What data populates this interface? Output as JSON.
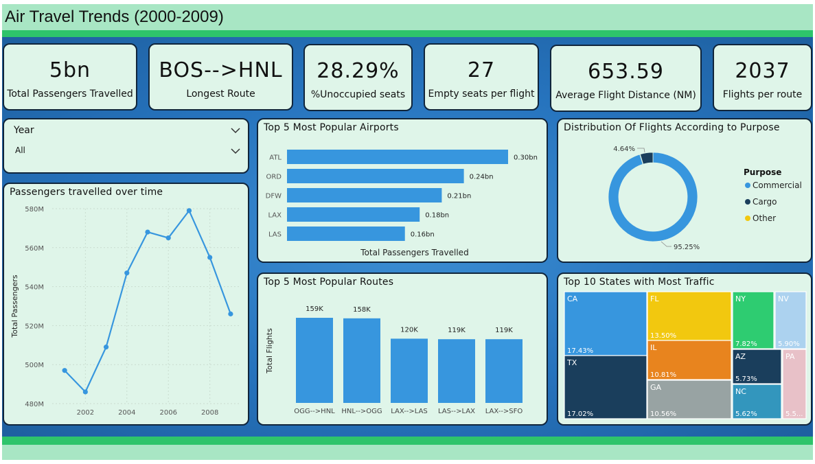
{
  "title": "Air Travel Trends (2000-2009)",
  "kpis": [
    {
      "value": "5bn",
      "label": "Total Passengers Travelled"
    },
    {
      "value": "BOS-->HNL",
      "label": "Longest Route"
    },
    {
      "value": "28.29%",
      "label": "%Unoccupied seats"
    },
    {
      "value": "27",
      "label": "Empty seats per flight"
    },
    {
      "value": "653.59",
      "label": "Average Flight Distance (NM)"
    },
    {
      "value": "2037",
      "label": "Flights per route"
    }
  ],
  "slicer": {
    "label": "Year",
    "value": "All"
  },
  "colors": {
    "accent": "#3796de",
    "dark": "#1a3e5c",
    "yellow": "#f2c80f",
    "card_bg": "#dff5e9",
    "title_bg": "#a8e6c4",
    "strip": "#2ec46b"
  },
  "chart_data": [
    {
      "type": "line",
      "title": "Passengers travelled over time",
      "ylabel": "Total Passengers",
      "xlabel": "",
      "x": [
        2000,
        2001,
        2002,
        2003,
        2004,
        2005,
        2006,
        2007,
        2008,
        2009
      ],
      "y": [
        497,
        486,
        509,
        547,
        568,
        565,
        579,
        555,
        526
      ],
      "x_points": [
        2001,
        2002,
        2003,
        2004,
        2005,
        2006,
        2007,
        2008,
        2009
      ],
      "x_ticks": [
        "2002",
        "2004",
        "2006",
        "2008"
      ],
      "y_ticks": [
        "580M",
        "560M",
        "540M",
        "520M",
        "500M",
        "480M"
      ],
      "ylim": [
        480,
        580
      ],
      "xlim": [
        2000.4,
        2009.5
      ],
      "grid": true
    },
    {
      "type": "bar",
      "orientation": "horizontal",
      "title": "Top 5 Most Popular Airports",
      "xlabel": "Total Passengers Travelled",
      "categories": [
        "ATL",
        "ORD",
        "DFW",
        "LAX",
        "LAS"
      ],
      "values": [
        0.3,
        0.24,
        0.21,
        0.18,
        0.16
      ],
      "data_labels": [
        "0.30bn",
        "0.24bn",
        "0.21bn",
        "0.18bn",
        "0.16bn"
      ]
    },
    {
      "type": "pie",
      "style": "donut",
      "title": "Distribution Of Flights According to Purpose",
      "legend_title": "Purpose",
      "legend_position": "right",
      "labels": [
        "Commercial",
        "Cargo",
        "Other"
      ],
      "values": [
        95.25,
        4.64,
        0.11
      ],
      "colors": [
        "#3796de",
        "#1a3e5c",
        "#f2c80f"
      ],
      "data_labels": [
        "95.25%",
        "4.64%"
      ]
    },
    {
      "type": "bar",
      "title": "Top 5 Most Popular Routes",
      "ylabel": "Total Flights",
      "categories": [
        "OGG-->HNL",
        "HNL-->OGG",
        "LAX-->LAS",
        "LAS-->LAX",
        "LAX-->SFO"
      ],
      "values": [
        159,
        158,
        120,
        119,
        119
      ],
      "data_labels": [
        "159K",
        "158K",
        "120K",
        "119K",
        "119K"
      ]
    },
    {
      "type": "treemap",
      "title": "Top 10 States with Most Traffic",
      "items": [
        {
          "state": "CA",
          "pct": "17.43%",
          "value": 17.43,
          "color": "#3796de"
        },
        {
          "state": "TX",
          "pct": "17.02%",
          "value": 17.02,
          "color": "#1a3e5c"
        },
        {
          "state": "FL",
          "pct": "13.50%",
          "value": 13.5,
          "color": "#f2c80f"
        },
        {
          "state": "IL",
          "pct": "10.81%",
          "value": 10.81,
          "color": "#e8841e"
        },
        {
          "state": "GA",
          "pct": "10.56%",
          "value": 10.56,
          "color": "#98a3a3"
        },
        {
          "state": "NY",
          "pct": "7.82%",
          "value": 7.82,
          "color": "#2ecc71"
        },
        {
          "state": "AZ",
          "pct": "5.73%",
          "value": 5.73,
          "color": "#1a3e5c"
        },
        {
          "state": "NC",
          "pct": "5.62%",
          "value": 5.62,
          "color": "#3396bd"
        },
        {
          "state": "NV",
          "pct": "5.90%",
          "value": 5.9,
          "color": "#acd2ef"
        },
        {
          "state": "PA",
          "pct": "5.5...",
          "value": 5.5,
          "color": "#e8c1c8"
        }
      ]
    }
  ]
}
